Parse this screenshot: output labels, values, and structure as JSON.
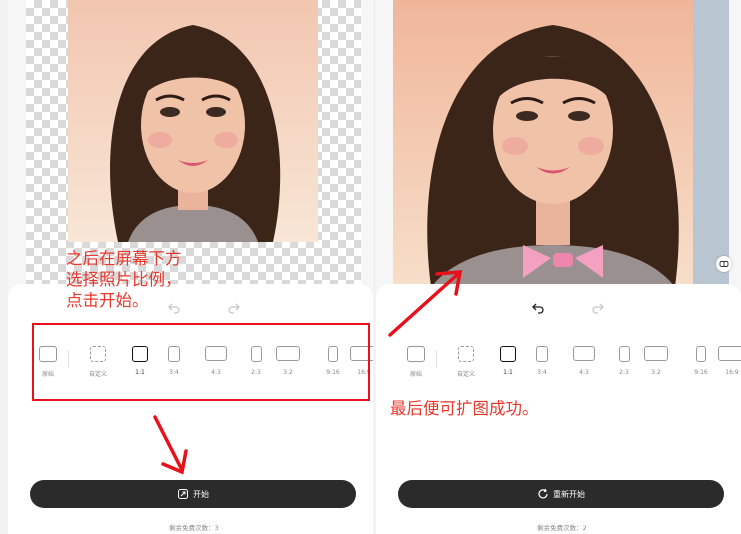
{
  "captions": {
    "left": "之后在屏幕下方\n选择照片比例，\n点击开始。",
    "right": "最后便可扩图成功。"
  },
  "ratio_options": [
    {
      "label": "原始",
      "shape": "original",
      "selected": false
    },
    {
      "label": "自定义",
      "shape": "custom",
      "selected": false
    },
    {
      "label": "1:1",
      "shape": "1:1",
      "selected": true
    },
    {
      "label": "3:4",
      "shape": "3:4",
      "selected": false
    },
    {
      "label": "4:3",
      "shape": "4:3",
      "selected": false
    },
    {
      "label": "2:3",
      "shape": "2:3",
      "selected": false
    },
    {
      "label": "3:2",
      "shape": "3:2",
      "selected": false
    },
    {
      "label": "9:16",
      "shape": "9:16",
      "selected": false
    },
    {
      "label": "16:9",
      "shape": "16:9",
      "selected": false
    }
  ],
  "left_panel": {
    "start_button": "开始",
    "remaining": "剩余免费次数：3"
  },
  "right_panel": {
    "restart_button": "重新开始",
    "remaining": "剩余免费次数：2"
  },
  "colors": {
    "annotation": "#e8372b",
    "highlight_box": "#e8101a",
    "primary_button": "#2b2b2b"
  },
  "icons": [
    "undo-icon",
    "redo-icon",
    "original-ratio-icon",
    "custom-ratio-icon",
    "expand-icon",
    "refresh-icon",
    "compare-icon"
  ]
}
